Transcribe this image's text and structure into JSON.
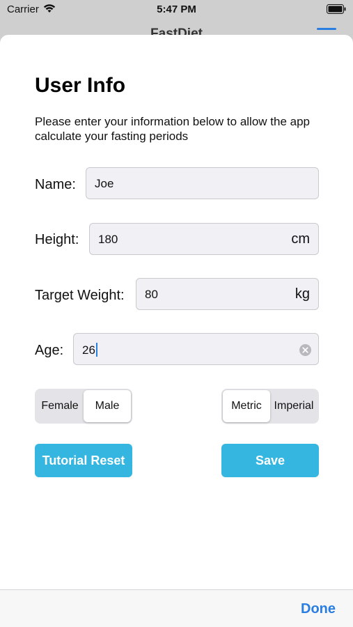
{
  "status_bar": {
    "carrier": "Carrier",
    "time": "5:47 PM"
  },
  "background_nav": {
    "title": "FastDiet"
  },
  "sheet": {
    "title": "User Info",
    "intro": "Please enter your information below to allow the app calculate your fasting periods"
  },
  "form": {
    "name": {
      "label": "Name:",
      "value": "Joe"
    },
    "height": {
      "label": "Height:",
      "value": "180",
      "unit": "cm"
    },
    "target_weight": {
      "label": "Target Weight:",
      "value": "80",
      "unit": "kg"
    },
    "age": {
      "label": "Age:",
      "value": "26"
    }
  },
  "gender_segment": {
    "options": [
      "Female",
      "Male"
    ],
    "selected": "Male"
  },
  "units_segment": {
    "options": [
      "Metric",
      "Imperial"
    ],
    "selected": "Metric"
  },
  "buttons": {
    "tutorial_reset": "Tutorial Reset",
    "save": "Save"
  },
  "toolbar": {
    "done": "Done"
  },
  "colors": {
    "accent": "#35b6e0",
    "link": "#2a7de1"
  }
}
